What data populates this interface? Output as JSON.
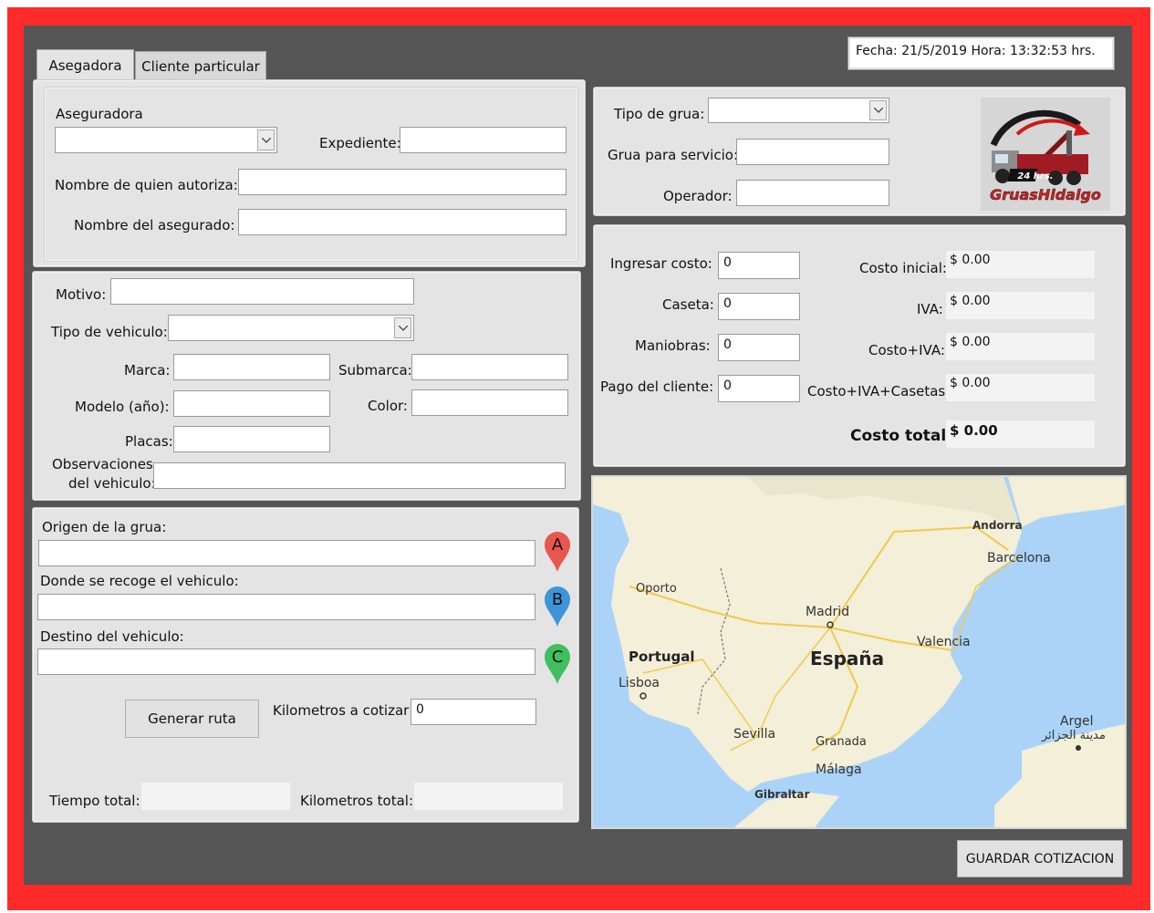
{
  "datetime": "Fecha: 21/5/2019  Hora: 13:32:53 hrs.",
  "tabs": [
    "Asegadora",
    "Cliente particular"
  ],
  "insurer": {
    "aseguradora_label": "Aseguradora",
    "aseguradora_value": "",
    "expediente_label": "Expediente:",
    "autoriza_label": "Nombre de quien autoriza:",
    "asegurado_label": "Nombre del asegurado:"
  },
  "vehicle": {
    "motivo_label": "Motivo:",
    "tipo_label": "Tipo de vehiculo:",
    "marca_label": "Marca:",
    "submarca_label": "Submarca:",
    "modelo_label": "Modelo (año):",
    "color_label": "Color:",
    "placas_label": "Placas:",
    "observaciones_label_1": "Observaciones",
    "observaciones_label_2": "del vehiculo:"
  },
  "route": {
    "origen_label": "Origen de la grua:",
    "recoge_label": "Donde se recoge el vehiculo:",
    "destino_label": "Destino del vehiculo:",
    "pin_a": "A",
    "pin_b": "B",
    "pin_c": "C",
    "pin_a_color": "#e8574f",
    "pin_b_color": "#3d95d8",
    "pin_c_color": "#3fbf5e",
    "generar_button": "Generar ruta",
    "km_cotizar_label": "Kilometros a cotizar",
    "km_cotizar_value": "0",
    "tiempo_total_label": "Tiempo total:",
    "km_total_label": "Kilometros total:"
  },
  "grua": {
    "tipo_label": "Tipo de grua:",
    "servicio_label": "Grua para servicio:",
    "operador_label": "Operador:",
    "logo_text": "GruasHidalgo",
    "logo_badge": "24 hrs."
  },
  "costs": {
    "ingresar_label": "Ingresar costo:",
    "ingresar_value": "0",
    "caseta_label": "Caseta:",
    "caseta_value": "0",
    "maniobras_label": "Maniobras:",
    "maniobras_value": "0",
    "pago_label": "Pago del cliente:",
    "pago_value": "0",
    "inicial_label": "Costo inicial:",
    "inicial_value": "$ 0.00",
    "iva_label": "IVA:",
    "iva_value": "$ 0.00",
    "costo_iva_label": "Costo+IVA:",
    "costo_iva_value": "$ 0.00",
    "costo_iva_casetas_label": "Costo+IVA+Casetas:",
    "costo_iva_casetas_value": "$ 0.00",
    "total_label": "Costo total:",
    "total_value": "$ 0.00"
  },
  "map": {
    "labels": {
      "andorra": "Andorra",
      "barcelona": "Barcelona",
      "oporto": "Oporto",
      "madrid": "Madrid",
      "valencia": "Valencia",
      "portugal": "Portugal",
      "espana": "España",
      "lisboa": "Lisboa",
      "sevilla": "Sevilla",
      "granada": "Granada",
      "malaga": "Málaga",
      "gibraltar": "Gibraltar",
      "argel": "Argel",
      "argel_ar": "مدينة الجزائر"
    }
  },
  "save_button": "GUARDAR COTIZACION"
}
